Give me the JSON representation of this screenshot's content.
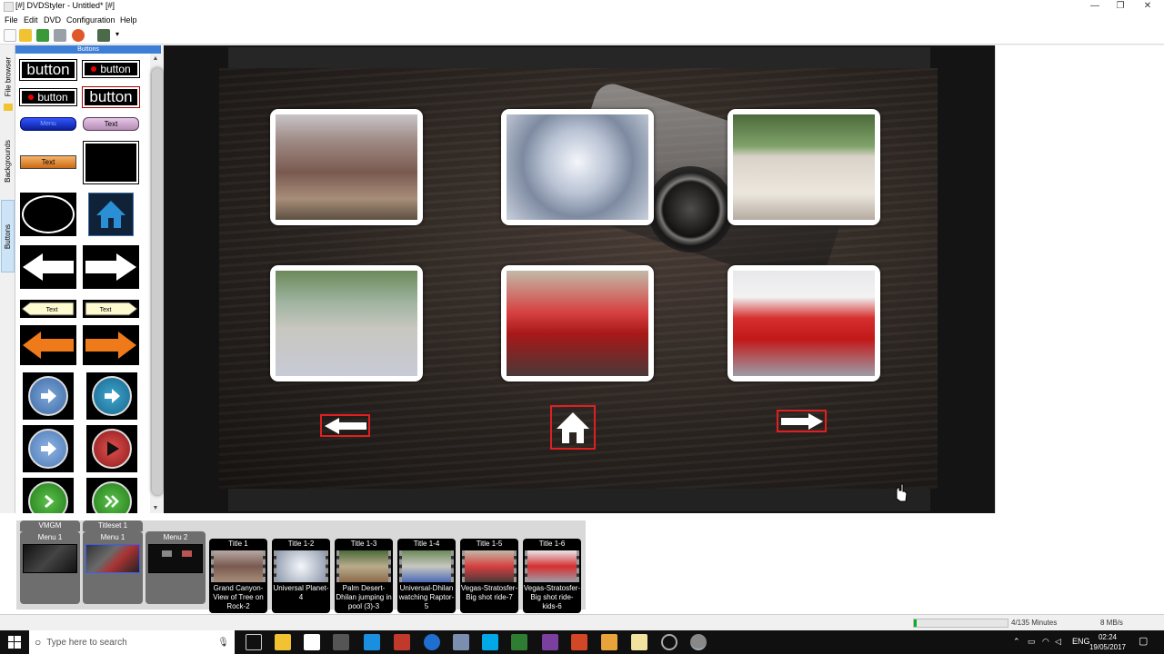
{
  "window": {
    "title": "[#] DVDStyler - Untitled* [#]",
    "controls": [
      "—",
      "❐",
      "✕"
    ]
  },
  "menubar": {
    "items": [
      "File",
      "Edit",
      "DVD",
      "Configuration",
      "Help"
    ]
  },
  "left_tabs": [
    "File browser",
    "Backgrounds",
    "Buttons"
  ],
  "palette": {
    "header": "Buttons",
    "items": [
      "button",
      "button",
      "button",
      "button",
      "Menu",
      "Text",
      "Text",
      "Text",
      "Text"
    ]
  },
  "canvas": {
    "thumbnails": [
      "grand-canyon",
      "universal-globe",
      "palm-desert",
      "universal-dhilan",
      "vegas-stratosfer",
      "vegas-stratosfer-kids"
    ],
    "nav_buttons": [
      "previous-arrow",
      "home",
      "next-arrow"
    ]
  },
  "titleset": {
    "groups": [
      {
        "label": "VMGM",
        "cells": [
          {
            "label": "Menu 1"
          }
        ]
      },
      {
        "label": "Titleset 1",
        "cells": [
          {
            "label": "Menu 1"
          },
          {
            "label": "Menu 2"
          }
        ]
      }
    ],
    "titles": [
      {
        "label": "Title 1",
        "desc": "Grand Canyon-View of Tree on Rock-2"
      },
      {
        "label": "Title 1-2",
        "desc": "Universal Planet-4"
      },
      {
        "label": "Title 1-3",
        "desc": "Palm Desert-Dhilan jumping in pool (3)-3"
      },
      {
        "label": "Title 1-4",
        "desc": "Universal-Dhilan watching Raptor-5"
      },
      {
        "label": "Title 1-5",
        "desc": "Vegas-Stratosfer-Big shot ride-7"
      },
      {
        "label": "Title 1-6",
        "desc": "Vegas-Stratosfer-Big shot ride-kids-6"
      }
    ]
  },
  "statusbar": {
    "minutes": "4/135 Minutes",
    "rate": "8 MB/s",
    "progress": 0.03
  },
  "taskbar": {
    "search_placeholder": "Type here to search",
    "language": "ENG",
    "time": "02:24",
    "date": "19/05/2017"
  },
  "colors": {
    "accent": "#3d7fd6",
    "nav_border": "#e02020",
    "taskbar": "#101010"
  }
}
